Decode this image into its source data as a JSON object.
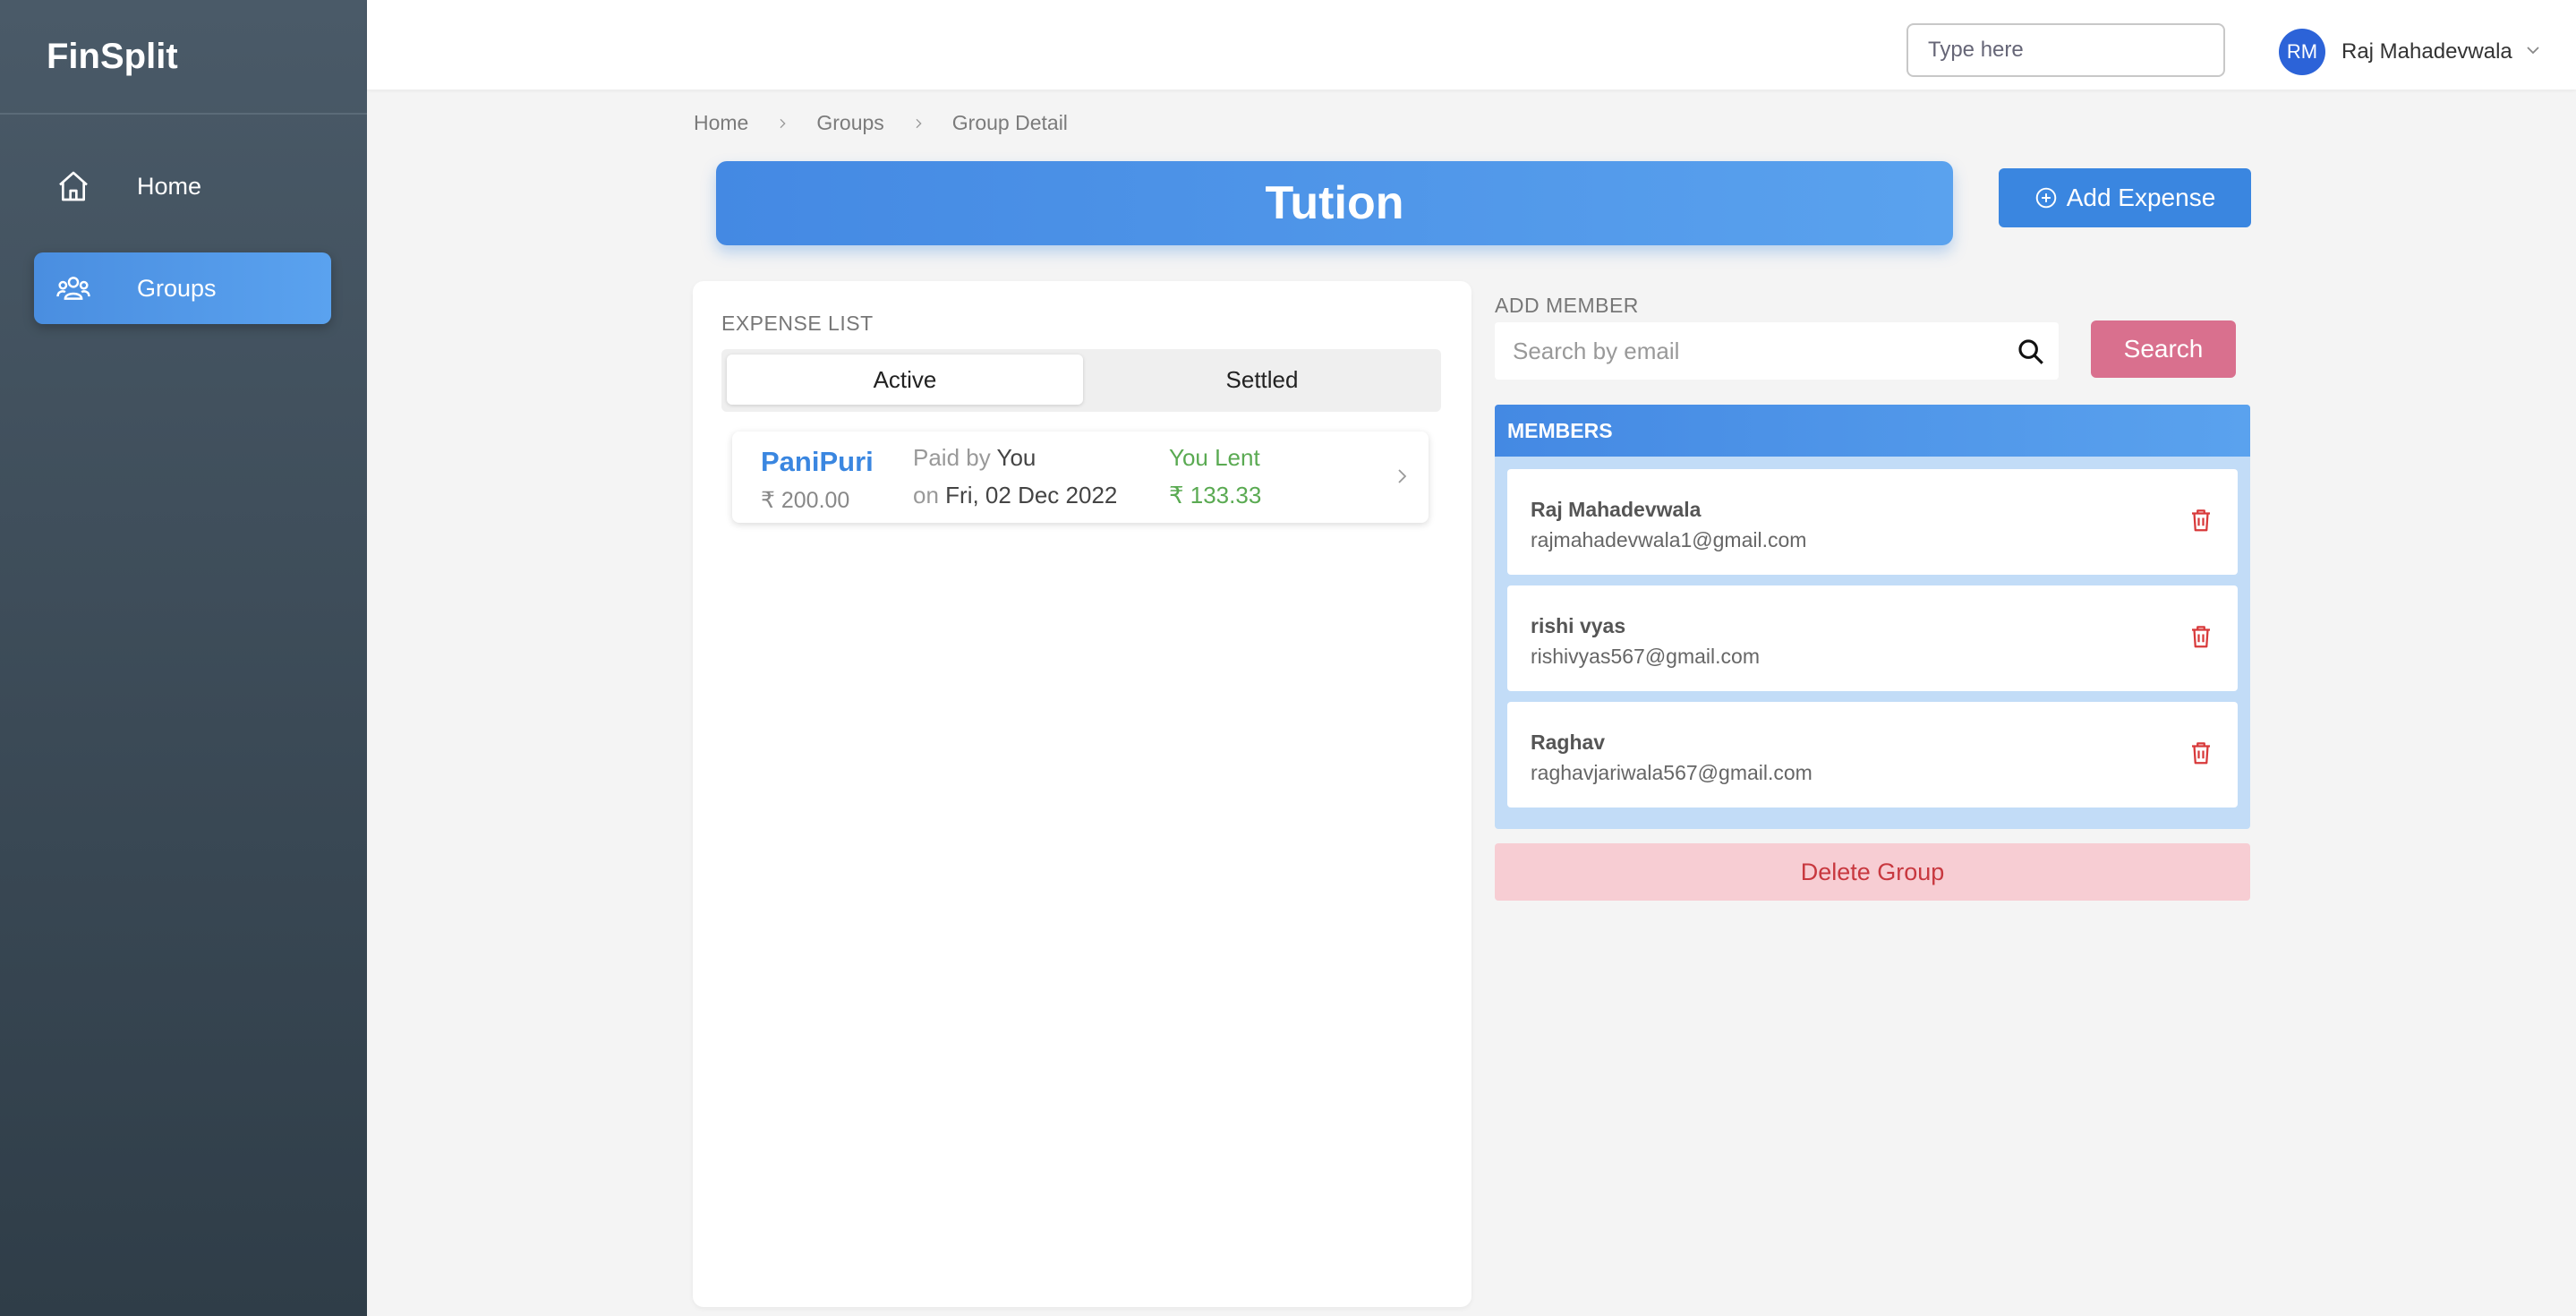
{
  "app": {
    "brand": "FinSplit"
  },
  "sidebar": {
    "items": [
      {
        "label": "Home",
        "icon": "home-icon"
      },
      {
        "label": "Groups",
        "icon": "groups-icon",
        "active": true
      }
    ]
  },
  "topbar": {
    "search_placeholder": "Type here",
    "user": {
      "initials": "RM",
      "name": "Raj Mahadevwala"
    }
  },
  "breadcrumb": [
    "Home",
    "Groups",
    "Group Detail"
  ],
  "group": {
    "title": "Tution"
  },
  "actions": {
    "add_expense": "Add Expense"
  },
  "expense_list": {
    "label": "EXPENSE LIST",
    "tabs": [
      "Active",
      "Settled"
    ],
    "active_tab": "Active",
    "items": [
      {
        "name": "PaniPuri",
        "amount": "₹ 200.00",
        "paid_by_label": "Paid by",
        "paid_by": "You",
        "on_label": "on",
        "date": "Fri, 02 Dec 2022",
        "status": "You Lent",
        "status_amount": "₹ 133.33"
      }
    ]
  },
  "add_member": {
    "label": "ADD MEMBER",
    "placeholder": "Search by email",
    "button": "Search"
  },
  "members": {
    "header": "MEMBERS",
    "list": [
      {
        "name": "Raj Mahadevwala",
        "email": "rajmahadevwala1@gmail.com"
      },
      {
        "name": "rishi vyas",
        "email": "rishivyas567@gmail.com"
      },
      {
        "name": "Raghav",
        "email": "raghavjariwala567@gmail.com"
      }
    ]
  },
  "delete_group": "Delete Group",
  "colors": {
    "primary": "#3a86e0",
    "sidebar": "#2f3d48",
    "search_button": "#d9708e",
    "lent": "#5aaa52",
    "danger": "#c8383f",
    "danger_bg": "#f7cdd3"
  }
}
